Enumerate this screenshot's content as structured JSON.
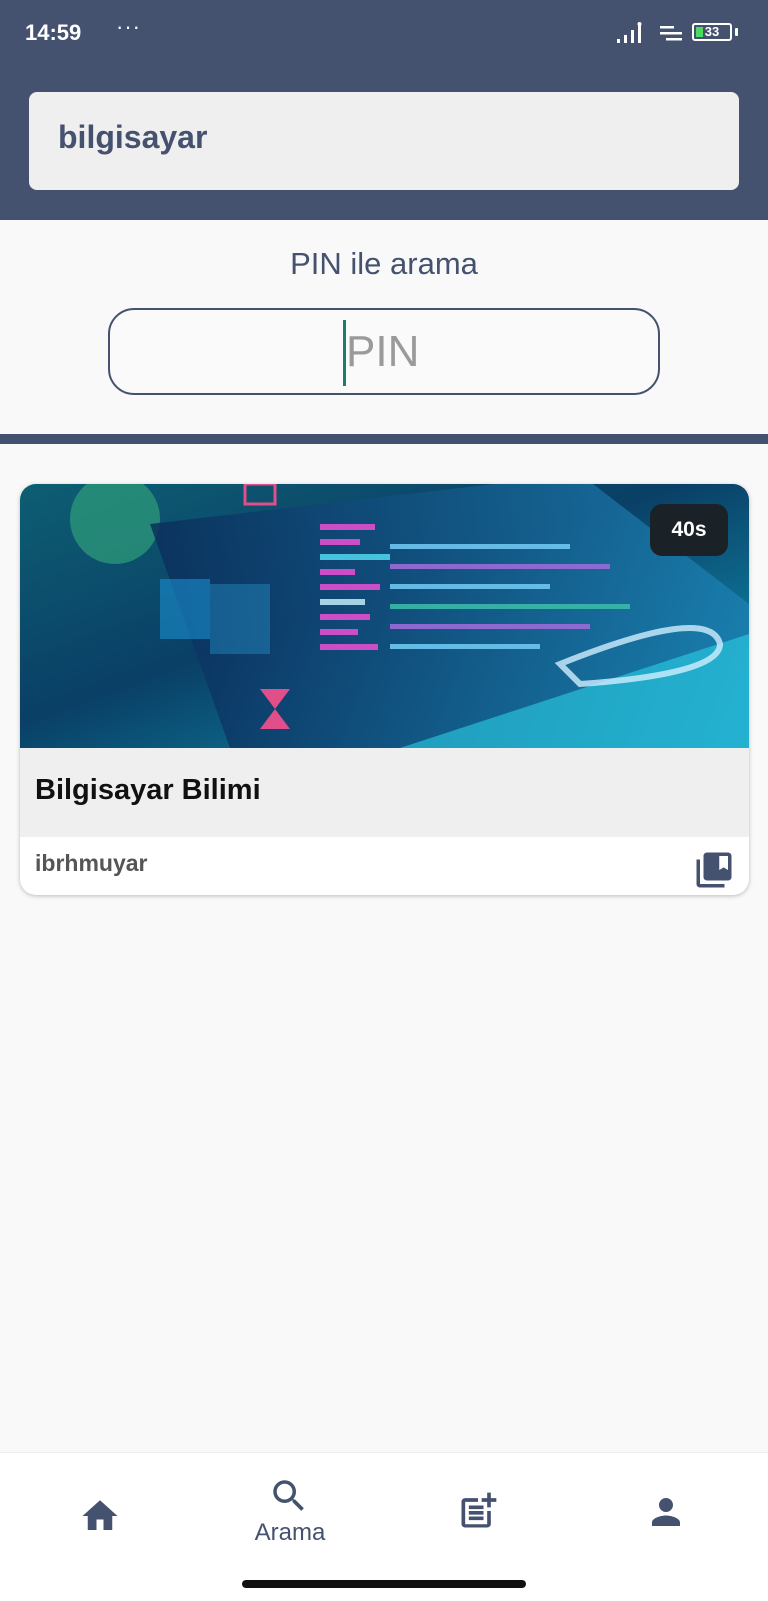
{
  "status_bar": {
    "time": "14:59",
    "dots": "···",
    "battery": "33"
  },
  "search": {
    "query": "bilgisayar"
  },
  "pin_section": {
    "title": "PIN ile arama",
    "placeholder": "PIN"
  },
  "results": [
    {
      "badge": "40s",
      "title": "Bilgisayar Bilimi",
      "author": "ibrhmuyar"
    }
  ],
  "bottom_nav": {
    "items": [
      {
        "icon": "home-icon",
        "label": ""
      },
      {
        "icon": "search-icon",
        "label": "Arama"
      },
      {
        "icon": "post-add-icon",
        "label": ""
      },
      {
        "icon": "person-icon",
        "label": ""
      }
    ]
  },
  "colors": {
    "primary": "#45526f",
    "background": "#f9f9f9",
    "caret": "#1b7d6d"
  }
}
